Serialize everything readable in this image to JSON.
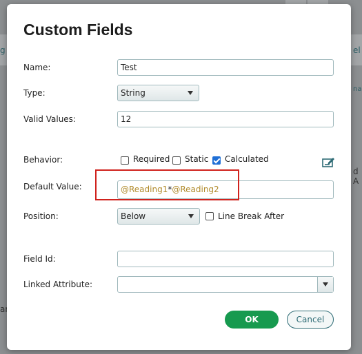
{
  "dialog": {
    "title": "Custom Fields",
    "name": {
      "label": "Name:",
      "value": "Test"
    },
    "type": {
      "label": "Type:",
      "value": "String"
    },
    "valid_values": {
      "label": "Valid Values:",
      "value": "12"
    },
    "behavior": {
      "label": "Behavior:",
      "required": {
        "label": "Required",
        "checked": false
      },
      "static": {
        "label": "Static",
        "checked": false
      },
      "calculated": {
        "label": "Calculated",
        "checked": true
      },
      "edit_icon": "edit-formula-icon"
    },
    "default_value": {
      "label": "Default Value:",
      "part1": "@Reading1",
      "operator": "*",
      "part2": "@Reading2"
    },
    "position": {
      "label": "Position:",
      "value": "Below"
    },
    "line_break": {
      "label": "Line Break After",
      "checked": false
    },
    "field_id": {
      "label": "Field Id:",
      "value": ""
    },
    "linked_attribute": {
      "label": "Linked Attribute:",
      "value": ""
    },
    "ok_label": "OK",
    "cancel_label": "Cancel"
  },
  "colors": {
    "ok_button": "#179a4f",
    "cancel_border": "#2d6b75",
    "formula_text": "#b08a2a",
    "highlight_box": "#d0221d",
    "checkbox_checked": "#1f6fd6"
  }
}
